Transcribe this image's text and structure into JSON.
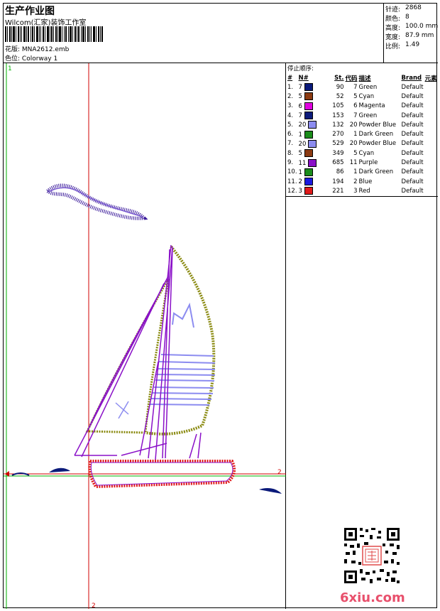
{
  "header": {
    "title": "生产作业图",
    "company": "Wilcom(汇家)装饰工作室",
    "design_label": "花版:",
    "design_value": "MNA2612.emb",
    "colorway_label": "色位:",
    "colorway_value": "Colorway 1"
  },
  "stats": [
    {
      "label": "针迹:",
      "value": "2868"
    },
    {
      "label": "颜色:",
      "value": "8"
    },
    {
      "label": "高度:",
      "value": "100.0 mm"
    },
    {
      "label": "宽度:",
      "value": "87.9 mm"
    },
    {
      "label": "比例:",
      "value": "1.49"
    }
  ],
  "markers": {
    "one": "1",
    "two": "2"
  },
  "stop_sequence": {
    "title": "停止顺序:",
    "columns": [
      "#",
      "N#",
      "St.",
      "代码",
      "描述",
      "Brand",
      "元素"
    ],
    "rows": [
      {
        "idx": "1.",
        "n": "7",
        "color": "#0b1a7a",
        "st": "90",
        "code": "7",
        "desc": "Green",
        "brand": "Default"
      },
      {
        "idx": "2.",
        "n": "5",
        "color": "#8b3a12",
        "st": "52",
        "code": "5",
        "desc": "Cyan",
        "brand": "Default"
      },
      {
        "idx": "3.",
        "n": "6",
        "color": "#e000e0",
        "st": "105",
        "code": "6",
        "desc": "Magenta",
        "brand": "Default"
      },
      {
        "idx": "4.",
        "n": "7",
        "color": "#0b1a7a",
        "st": "153",
        "code": "7",
        "desc": "Green",
        "brand": "Default"
      },
      {
        "idx": "5.",
        "n": "20",
        "color": "#8c8cf0",
        "st": "132",
        "code": "20",
        "desc": "Powder Blue",
        "brand": "Default"
      },
      {
        "idx": "6.",
        "n": "1",
        "color": "#1a8c1a",
        "st": "270",
        "code": "1",
        "desc": "Dark Green",
        "brand": "Default"
      },
      {
        "idx": "7.",
        "n": "20",
        "color": "#8c8cf0",
        "st": "529",
        "code": "20",
        "desc": "Powder Blue",
        "brand": "Default"
      },
      {
        "idx": "8.",
        "n": "5",
        "color": "#8b3a12",
        "st": "349",
        "code": "5",
        "desc": "Cyan",
        "brand": "Default"
      },
      {
        "idx": "9.",
        "n": "11",
        "color": "#8a10c8",
        "st": "685",
        "code": "11",
        "desc": "Purple",
        "brand": "Default"
      },
      {
        "idx": "10.",
        "n": "1",
        "color": "#1a8c1a",
        "st": "86",
        "code": "1",
        "desc": "Dark Green",
        "brand": "Default"
      },
      {
        "idx": "11.",
        "n": "2",
        "color": "#1a1ae0",
        "st": "194",
        "code": "2",
        "desc": "Blue",
        "brand": "Default"
      },
      {
        "idx": "12.",
        "n": "3",
        "color": "#e01a1a",
        "st": "221",
        "code": "3",
        "desc": "Red",
        "brand": "Default"
      }
    ]
  },
  "watermark": {
    "text": "6xiu.com"
  },
  "colors": {
    "axis_red": "#d00000",
    "axis_green": "#00b000",
    "purple": "#8a10c8",
    "olive": "#8a8a10",
    "powder": "#8c8cf0",
    "navy": "#0b1a7a"
  }
}
